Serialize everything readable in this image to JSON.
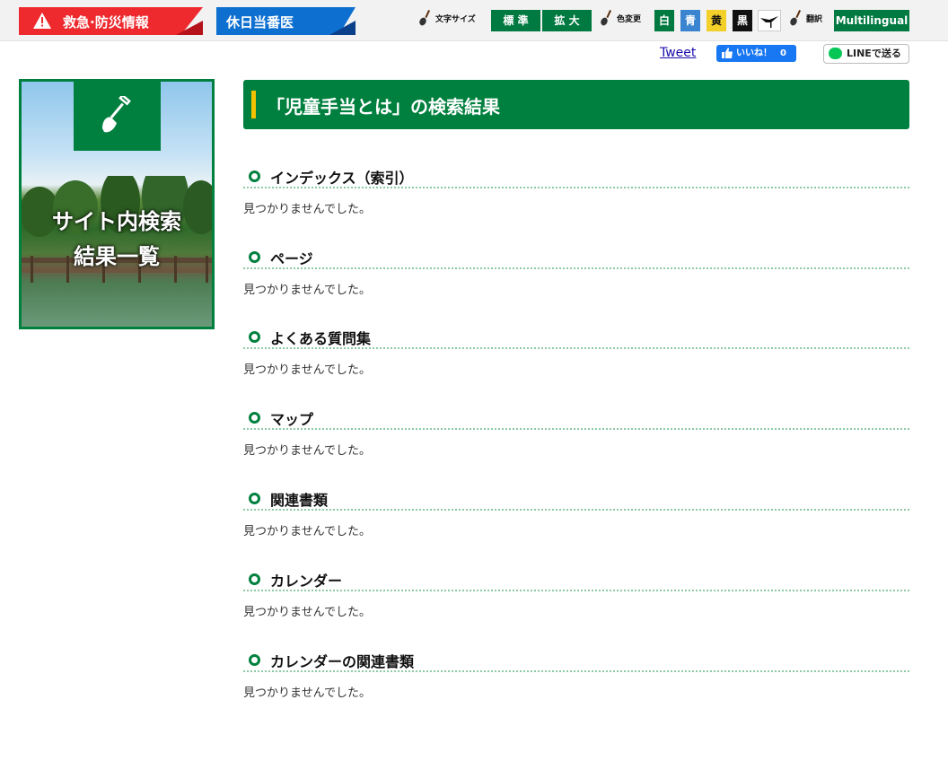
{
  "header": {
    "emergency_label": "救急·防災情報",
    "holiday_label": "休日当番医",
    "font_size_label": "文字サイズ",
    "font_standard": "標 準",
    "font_large": "拡 大",
    "color_change_label": "色変更",
    "color_white": "白",
    "color_blue": "青",
    "color_yellow": "黄",
    "color_black": "黒",
    "translate_label": "翻訳",
    "multilingual": "Multilingual"
  },
  "social": {
    "tweet": "Tweet",
    "fb_like": "いいね！",
    "fb_count": "0",
    "line_send": "LINEで送る"
  },
  "sidebar": {
    "banner_line1": "サイト内検索",
    "banner_line2": "結果一覧"
  },
  "main": {
    "title": "「児童手当とは」の検索結果",
    "sections": [
      {
        "heading": "インデックス（索引）",
        "message": "見つかりませんでした。"
      },
      {
        "heading": "ページ",
        "message": "見つかりませんでした。"
      },
      {
        "heading": "よくある質問集",
        "message": "見つかりませんでした。"
      },
      {
        "heading": "マップ",
        "message": "見つかりませんでした。"
      },
      {
        "heading": "関連書類",
        "message": "見つかりませんでした。"
      },
      {
        "heading": "カレンダー",
        "message": "見つかりませんでした。"
      },
      {
        "heading": "カレンダーの関連書類",
        "message": "見つかりませんでした。"
      }
    ]
  },
  "colors": {
    "brand_green": "#00803e",
    "emergency_red": "#ee2a2f",
    "holiday_blue": "#0d6fd0",
    "accent_yellow": "#f2c200"
  },
  "icons": [
    "warning-icon",
    "shovel-icon",
    "bird-icon",
    "facebook-thumb-icon",
    "line-icon",
    "bullet-icon"
  ]
}
